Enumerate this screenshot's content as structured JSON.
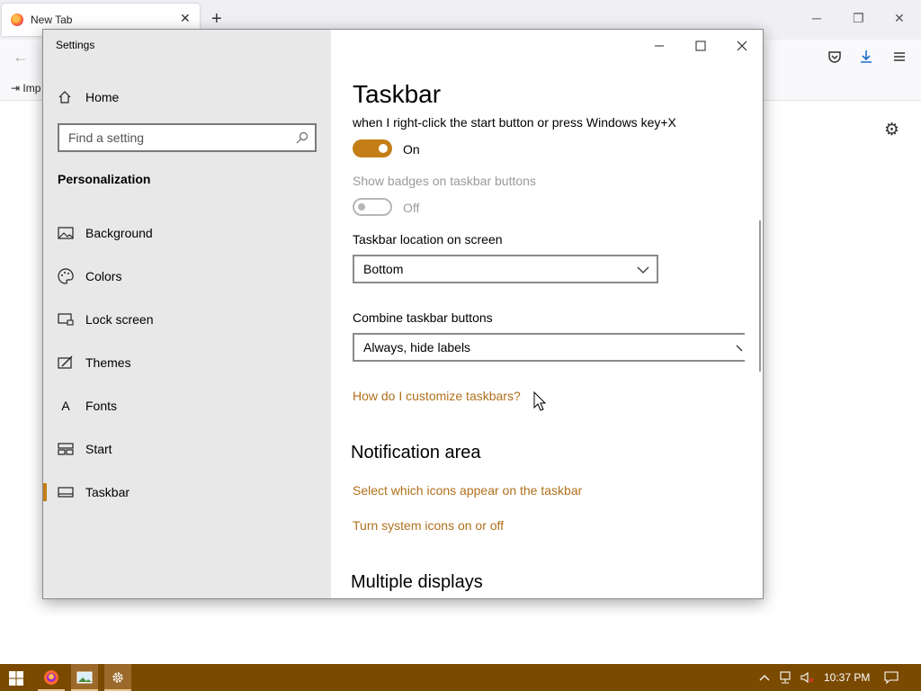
{
  "browser": {
    "tab_title": "New Tab",
    "tab_close": "✕",
    "new_tab": "+",
    "import_label": "Imp",
    "win_minimize": "─",
    "win_restore": "❐",
    "win_close": "✕"
  },
  "settings": {
    "window_title": "Settings",
    "home_label": "Home",
    "search_placeholder": "Find a setting",
    "section_header": "Personalization",
    "nav_items": [
      {
        "label": "Background",
        "icon": "image-icon"
      },
      {
        "label": "Colors",
        "icon": "palette-icon"
      },
      {
        "label": "Lock screen",
        "icon": "lock-screen-icon"
      },
      {
        "label": "Themes",
        "icon": "themes-icon"
      },
      {
        "label": "Fonts",
        "icon": "fonts-icon"
      },
      {
        "label": "Start",
        "icon": "start-icon"
      },
      {
        "label": "Taskbar",
        "icon": "taskbar-icon",
        "selected": true
      }
    ],
    "fonts_glyph": "A",
    "page_title": "Taskbar",
    "powershell_text": "when I right-click the start button or press Windows key+X",
    "powershell_toggle_state": "On",
    "badges_label": "Show badges on taskbar buttons",
    "badges_toggle_state": "Off",
    "location_label": "Taskbar location on screen",
    "location_value": "Bottom",
    "combine_label": "Combine taskbar buttons",
    "combine_value": "Always, hide labels",
    "help_link": "How do I customize taskbars?",
    "notification_heading": "Notification area",
    "notification_link_1": "Select which icons appear on the taskbar",
    "notification_link_2": "Turn system icons on or off",
    "multiple_displays_heading": "Multiple displays"
  },
  "taskbar": {
    "clock": "10:37 PM"
  },
  "colors": {
    "accent": "#c47e18",
    "link": "#b0701c",
    "taskbar": "#7a4a00",
    "sidebar": "#e8e8e8"
  }
}
